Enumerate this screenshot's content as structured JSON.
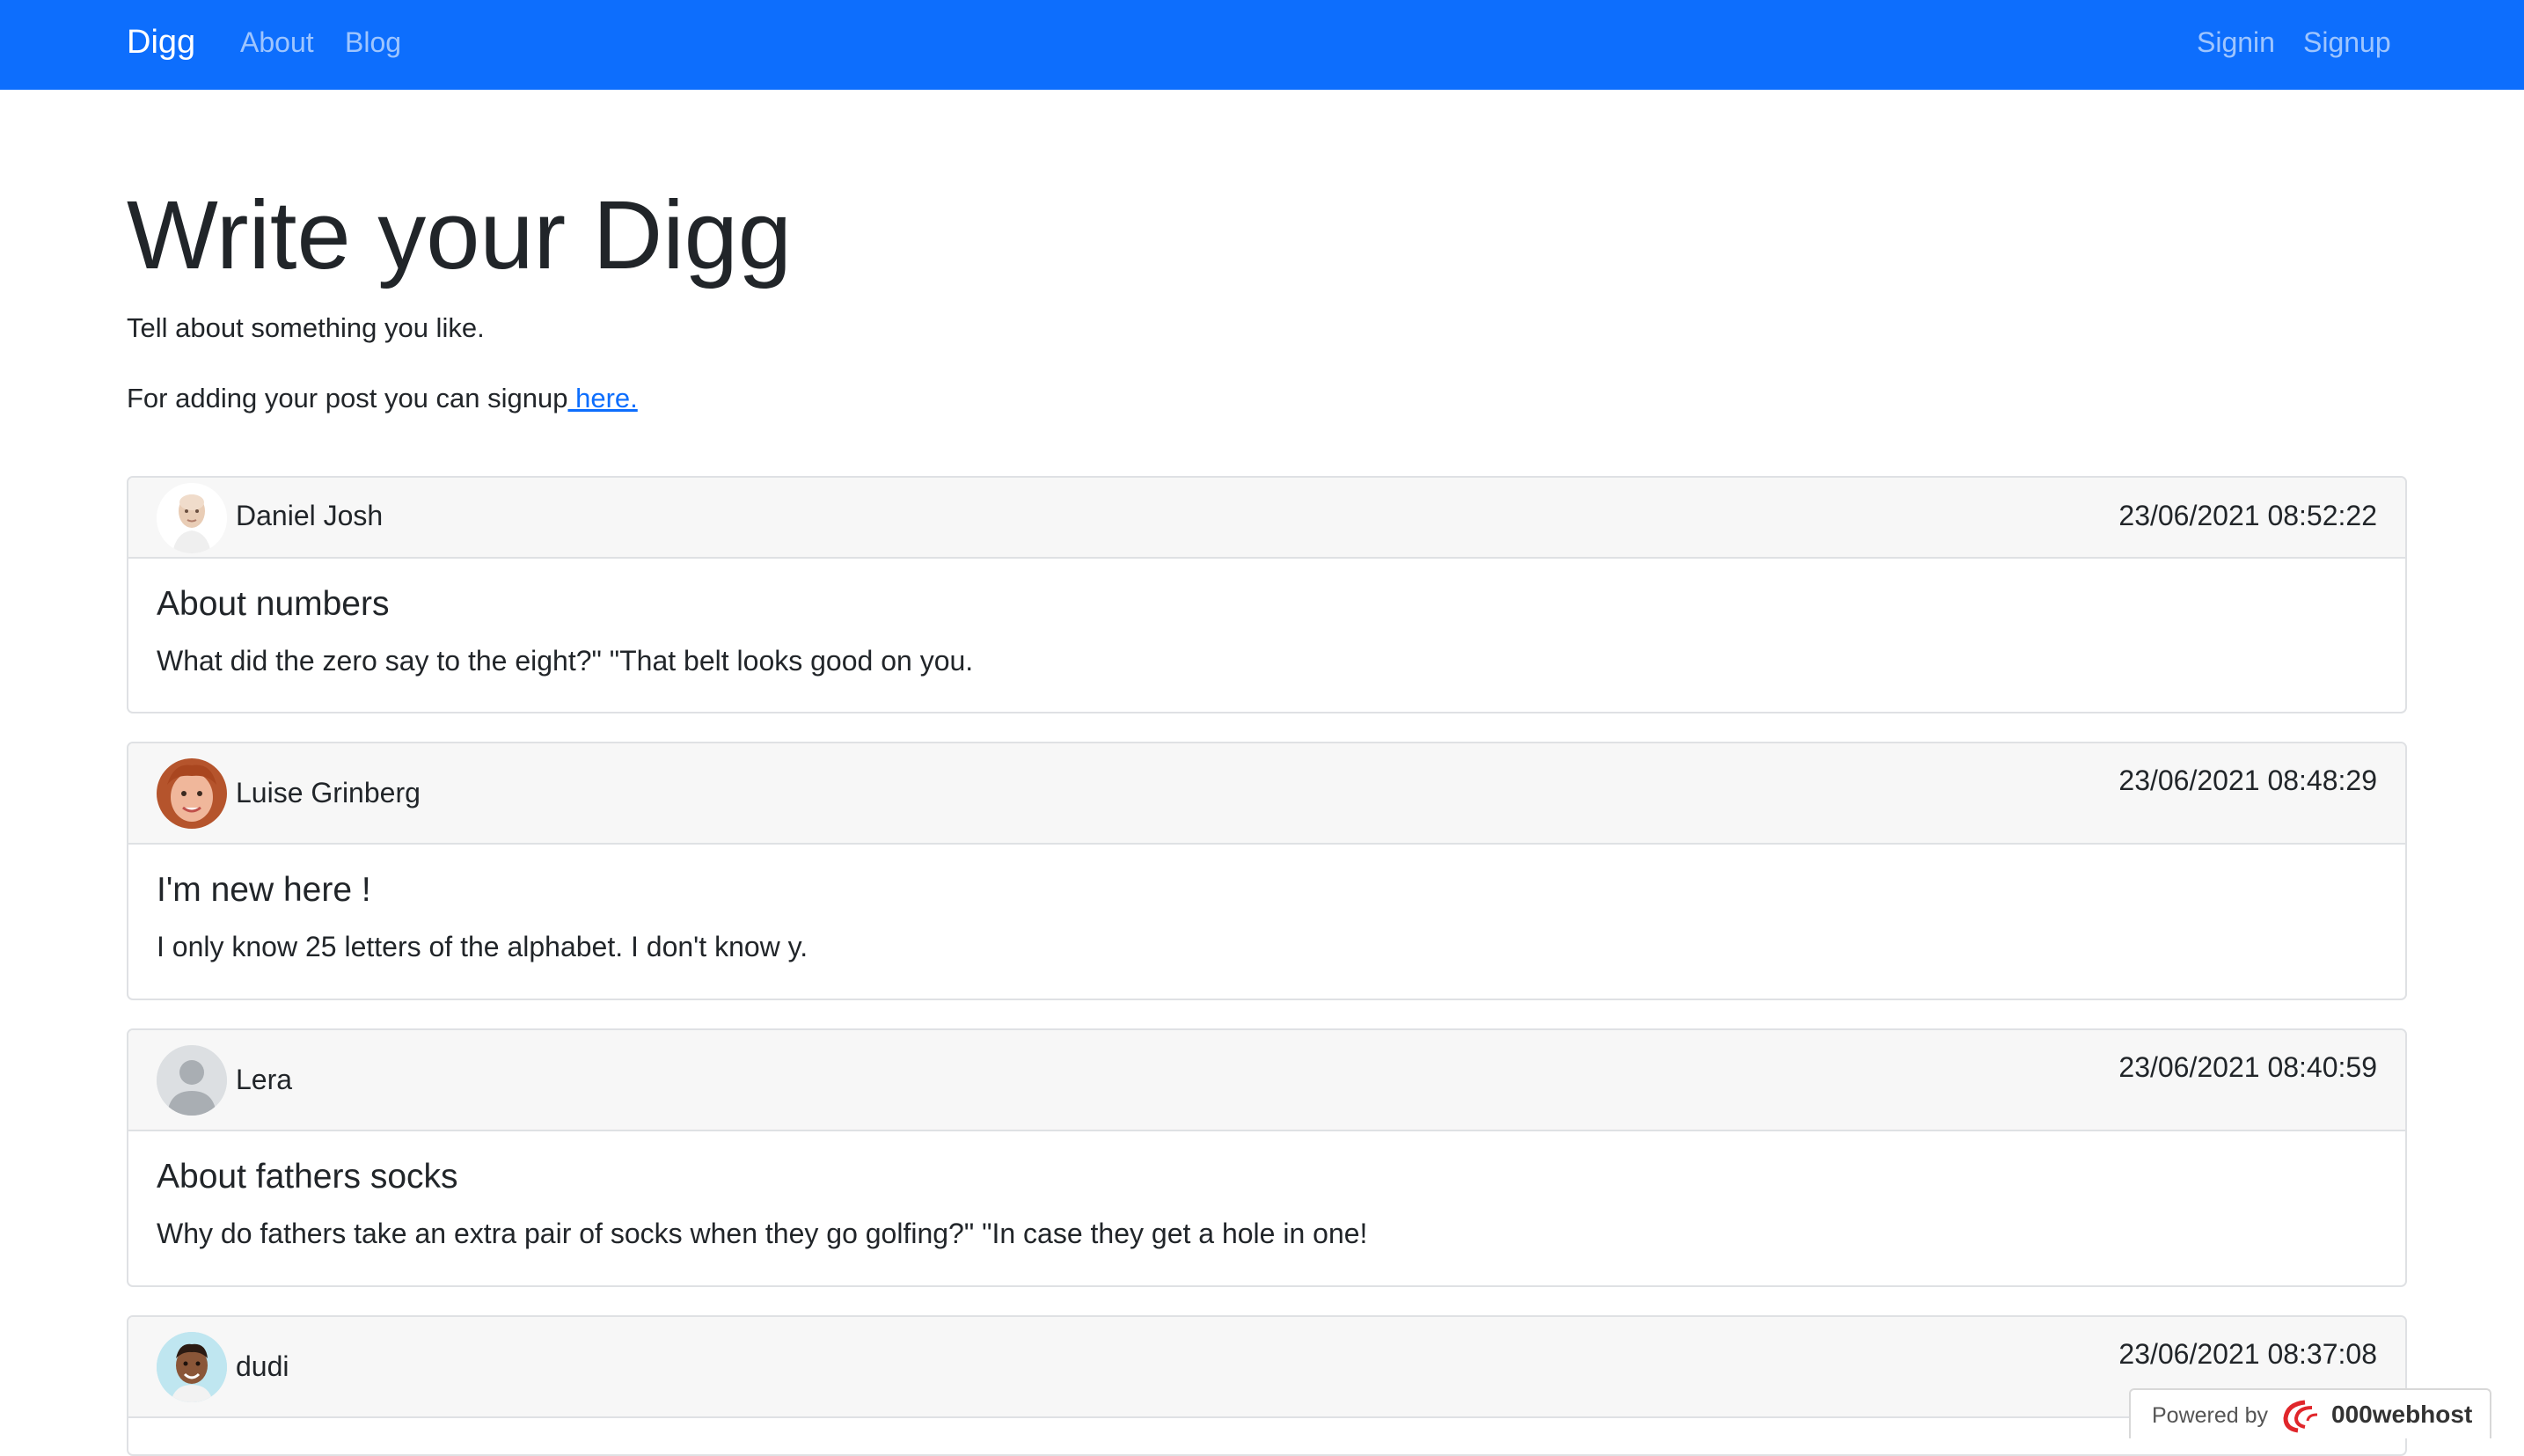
{
  "navbar": {
    "brand": "Digg",
    "links": [
      "About",
      "Blog"
    ],
    "auth": [
      "Signin",
      "Signup"
    ]
  },
  "hero": {
    "title": "Write your Digg",
    "lead": "Tell about something you like.",
    "signup_text": "For adding your post you can signup",
    "signup_link": " here."
  },
  "posts": [
    {
      "author": "Daniel Josh",
      "date": "23/06/2021 08:52:22",
      "title": "About numbers",
      "text": "What did the zero say to the eight?\" \"That belt looks good on you."
    },
    {
      "author": "Luise Grinberg",
      "date": "23/06/2021 08:48:29",
      "title": "I'm new here !",
      "text": "I only know 25 letters of the alphabet. I don't know y."
    },
    {
      "author": "Lera",
      "date": "23/06/2021 08:40:59",
      "title": "About fathers socks",
      "text": "Why do fathers take an extra pair of socks when they go golfing?\" \"In case they get a hole in one!"
    },
    {
      "author": "dudi",
      "date": "23/06/2021 08:37:08",
      "title": "",
      "text": ""
    }
  ],
  "footer_badge": {
    "prefix": "Powered by",
    "host": "000webhost"
  },
  "colors": {
    "navbar": "#0d6efd",
    "link": "#0d6efd",
    "card_header": "#f7f7f7",
    "border": "#dfe1e4"
  }
}
